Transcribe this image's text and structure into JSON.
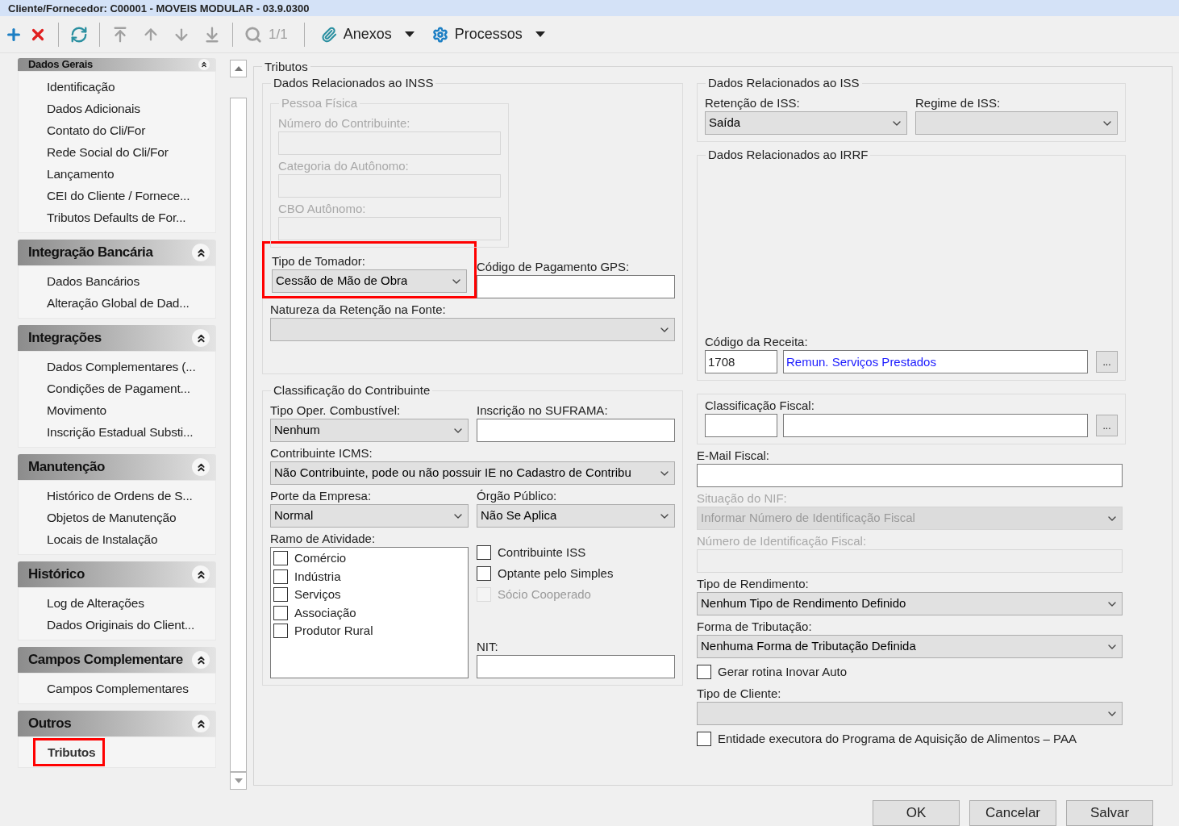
{
  "window": {
    "title": "Cliente/Fornecedor: C00001 - MOVEIS MODULAR - 03.9.0300"
  },
  "toolbar": {
    "page": "1/1",
    "menus": [
      "Anexos",
      "Processos"
    ]
  },
  "sidebar": {
    "groups": [
      {
        "title": "Dados Gerais",
        "expanded": true,
        "items": [
          {
            "label": "Identificação",
            "selected": false,
            "highlighted": false
          },
          {
            "label": "Dados Adicionais",
            "selected": false,
            "highlighted": false
          },
          {
            "label": "Contato do Cli/For",
            "selected": false,
            "highlighted": false
          },
          {
            "label": "Rede Social do Cli/For",
            "selected": false,
            "highlighted": false
          },
          {
            "label": "Lançamento",
            "selected": false,
            "highlighted": false
          },
          {
            "label": "CEI do Cliente /  Fornece...",
            "selected": false,
            "highlighted": false
          },
          {
            "label": "Tributos Defaults de For...",
            "selected": false,
            "highlighted": false
          }
        ]
      },
      {
        "title": "Integração Bancária",
        "expanded": true,
        "items": [
          {
            "label": "Dados Bancários",
            "selected": false,
            "highlighted": false
          },
          {
            "label": "Alteração Global de Dad...",
            "selected": false,
            "highlighted": false
          }
        ]
      },
      {
        "title": "Integrações",
        "expanded": true,
        "items": [
          {
            "label": "Dados Complementares (...",
            "selected": false,
            "highlighted": false
          },
          {
            "label": "Condições de Pagament...",
            "selected": false,
            "highlighted": false
          },
          {
            "label": "Movimento",
            "selected": false,
            "highlighted": false
          },
          {
            "label": "Inscrição Estadual Substi...",
            "selected": false,
            "highlighted": false
          }
        ]
      },
      {
        "title": "Manutenção",
        "expanded": true,
        "items": [
          {
            "label": "Histórico de Ordens de S...",
            "selected": false,
            "highlighted": false
          },
          {
            "label": "Objetos de Manutenção",
            "selected": false,
            "highlighted": false
          },
          {
            "label": "Locais de Instalação",
            "selected": false,
            "highlighted": false
          }
        ]
      },
      {
        "title": "Histórico",
        "expanded": true,
        "items": [
          {
            "label": "Log de Alterações",
            "selected": false,
            "highlighted": false
          },
          {
            "label": "Dados Originais do Client...",
            "selected": false,
            "highlighted": false
          }
        ]
      },
      {
        "title": "Campos Complementare",
        "expanded": true,
        "items": [
          {
            "label": "Campos Complementares",
            "selected": false,
            "highlighted": false
          }
        ]
      },
      {
        "title": "Outros",
        "expanded": true,
        "items": [
          {
            "label": "Tributos",
            "selected": true,
            "highlighted": true
          }
        ]
      }
    ]
  },
  "tributos": {
    "title": "Tributos",
    "left": [
      {
        "kind": "group",
        "title": "Dados Relacionados ao INSS",
        "children": [
          {
            "kind": "group",
            "title": "Pessoa Física",
            "disabled": true,
            "children": [
              {
                "kind": "text",
                "label": "Número do Contribuinte:",
                "disabled": true
              },
              {
                "kind": "text",
                "label": "Categoria do Autônomo:",
                "disabled": true
              },
              {
                "kind": "text",
                "label": "CBO Autônomo:",
                "disabled": true
              }
            ]
          },
          {
            "kind": "row",
            "children": [
              {
                "kind": "select",
                "label": "Tipo de Tomador:",
                "value": "Cessão de Mão de Obra",
                "highlighted": true
              },
              {
                "kind": "text",
                "label": "Código de Pagamento GPS:"
              }
            ]
          },
          {
            "kind": "select",
            "label": "Natureza da Retenção na Fonte:"
          }
        ]
      },
      {
        "kind": "group",
        "title": "Classificação do Contribuinte",
        "children": [
          {
            "kind": "row",
            "children": [
              {
                "kind": "select",
                "label": "Tipo Oper. Combustível:",
                "value": "Nenhum"
              },
              {
                "kind": "text",
                "label": "Inscrição no SUFRAMA:"
              }
            ]
          },
          {
            "kind": "select",
            "label": "Contribuinte ICMS:",
            "value": "Não Contribuinte, pode ou não possuir IE no Cadastro de Contribu"
          },
          {
            "kind": "row",
            "children": [
              {
                "kind": "select",
                "label": "Porte da Empresa:",
                "value": "Normal"
              },
              {
                "kind": "select",
                "label": "Órgão Público:",
                "value": "Não Se Aplica"
              }
            ]
          },
          {
            "kind": "row",
            "children": [
              {
                "kind": "checklist",
                "label": "Ramo de Atividade:",
                "items": [
                  {
                    "label": "Comércio",
                    "checked": false
                  },
                  {
                    "label": "Indústria",
                    "checked": false
                  },
                  {
                    "label": "Serviços",
                    "checked": false
                  },
                  {
                    "label": "Associação",
                    "checked": false
                  },
                  {
                    "label": "Produtor Rural",
                    "checked": false
                  }
                ]
              },
              {
                "kind": "column",
                "children": [
                  {
                    "kind": "checkbox",
                    "label": "Contribuinte ISS",
                    "checked": false
                  },
                  {
                    "kind": "checkbox",
                    "label": "Optante pelo Simples",
                    "checked": false
                  },
                  {
                    "kind": "checkbox",
                    "label": "Sócio Cooperado",
                    "checked": false,
                    "disabled": true
                  },
                  {
                    "kind": "text",
                    "label": "NIT:"
                  }
                ]
              }
            ]
          }
        ]
      }
    ],
    "right": [
      {
        "kind": "group",
        "title": "Dados Relacionados ao ISS",
        "children": [
          {
            "kind": "row",
            "children": [
              {
                "kind": "select",
                "label": "Retenção de ISS:",
                "value": "Saída"
              },
              {
                "kind": "select",
                "label": "Regime de ISS:"
              }
            ]
          }
        ]
      },
      {
        "kind": "group",
        "title": "Dados Relacionados ao IRRF",
        "children": [
          {
            "kind": "lookup",
            "label": "Código da Receita:",
            "code": "1708",
            "description": "Remun. Serviços Prestados",
            "button": "..."
          }
        ]
      },
      {
        "kind": "group",
        "children": [
          {
            "kind": "lookup",
            "label": "Classificação Fiscal:",
            "button": "..."
          }
        ]
      },
      {
        "kind": "text",
        "label": "E-Mail Fiscal:"
      },
      {
        "kind": "select",
        "label": "Situação do NIF:",
        "value": "Informar Número de Identificação Fiscal",
        "disabled": true
      },
      {
        "kind": "text",
        "label": "Número de Identificação Fiscal:",
        "disabled": true
      },
      {
        "kind": "select",
        "label": "Tipo de Rendimento:",
        "value": "Nenhum Tipo de Rendimento Definido"
      },
      {
        "kind": "select",
        "label": "Forma de Tributação:",
        "value": "Nenhuma Forma de Tributação Definida"
      },
      {
        "kind": "checkbox",
        "label": "Gerar rotina Inovar Auto",
        "checked": false
      },
      {
        "kind": "select",
        "label": "Tipo de Cliente:"
      },
      {
        "kind": "checkbox",
        "label": "Entidade executora do Programa de Aquisição de Alimentos – PAA",
        "checked": false
      }
    ]
  },
  "buttons": [
    "OK",
    "Cancelar",
    "Salvar"
  ]
}
